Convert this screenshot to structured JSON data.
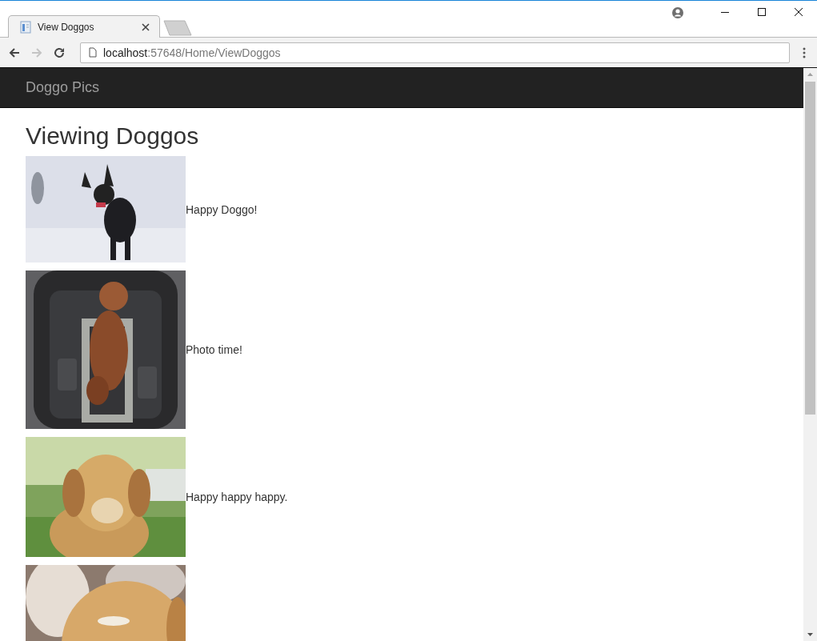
{
  "browser": {
    "tabs": [
      {
        "title": "View Doggos",
        "selected": true
      }
    ],
    "address": {
      "host": "localhost",
      "rest": ":57648/Home/ViewDoggos"
    }
  },
  "navbar": {
    "brand": "Doggo Pics"
  },
  "heading": "Viewing Doggos",
  "photos": [
    {
      "kind": "picture",
      "caption": "Happy Doggo!"
    },
    {
      "kind": "picture",
      "caption": "Photo time!"
    },
    {
      "kind": "picture",
      "caption": "Happy happy happy."
    },
    {
      "kind": "picture"
    }
  ]
}
